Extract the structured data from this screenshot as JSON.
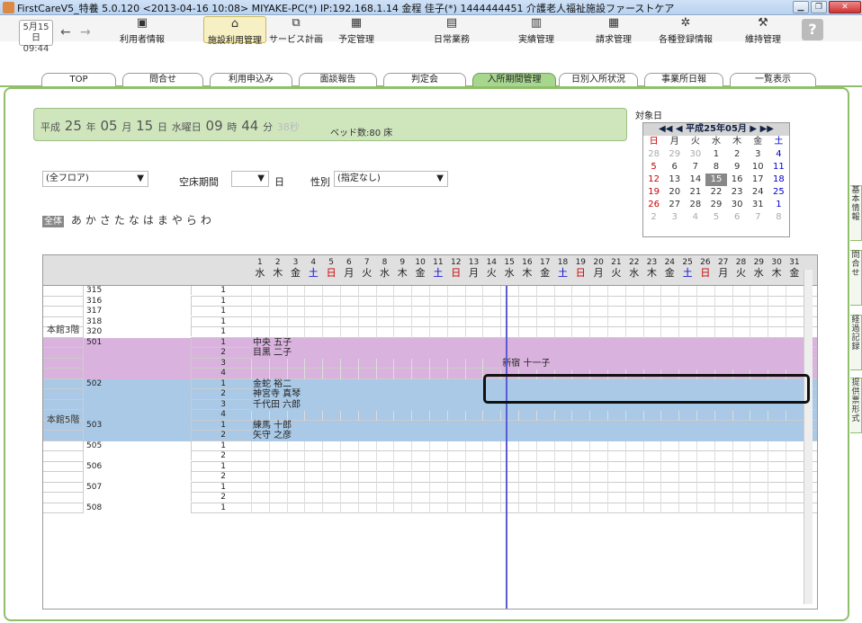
{
  "window": {
    "title": "FirstCareV5_特養 5.0.120 <2013-04-16 10:08> MIYAKE-PC(*) IP:192.168.1.14 金程 佳子(*) 1444444451 介護老人福祉施設ファーストケア"
  },
  "clock": {
    "date": "5月15日",
    "time": "09:44"
  },
  "toolbar": [
    "利用者情報",
    "施設利用管理",
    "サービス計画",
    "予定管理",
    "日常業務",
    "実績管理",
    "請求管理",
    "各種登録情報",
    "維持管理"
  ],
  "tabs": [
    "TOP",
    "問合せ",
    "利用申込み",
    "面談報告",
    "判定会",
    "入所期間管理",
    "日別入所状況",
    "事業所日報",
    "一覧表示"
  ],
  "header": {
    "era": "平成",
    "year": "25",
    "y": "年",
    "month": "05",
    "m": "月",
    "day": "15",
    "d": "日",
    "wday": "水曜日",
    "hour": "09",
    "h": "時",
    "min": "44",
    "mi": "分",
    "sec": "38秒",
    "beds": "ベッド数:80 床"
  },
  "calendar": {
    "label": "対象日",
    "title": "平成25年05月",
    "weekdays": [
      "日",
      "月",
      "火",
      "水",
      "木",
      "金",
      "土"
    ],
    "rows": [
      [
        "28",
        "29",
        "30",
        "1",
        "2",
        "3",
        "4"
      ],
      [
        "5",
        "6",
        "7",
        "8",
        "9",
        "10",
        "11"
      ],
      [
        "12",
        "13",
        "14",
        "15",
        "16",
        "17",
        "18"
      ],
      [
        "19",
        "20",
        "21",
        "22",
        "23",
        "24",
        "25"
      ],
      [
        "26",
        "27",
        "28",
        "29",
        "30",
        "31",
        "1"
      ],
      [
        "2",
        "3",
        "4",
        "5",
        "6",
        "7",
        "8"
      ]
    ]
  },
  "filters": {
    "floor": "(全フロア)",
    "vacancy_label": "空床期間",
    "vacancy_unit": "日",
    "gender_label": "性別",
    "gender": "(指定なし)"
  },
  "kana": {
    "all": "全体",
    "letters": "あかさたなはまやらわ"
  },
  "days": {
    "nums": [
      "1",
      "2",
      "3",
      "4",
      "5",
      "6",
      "7",
      "8",
      "9",
      "10",
      "11",
      "12",
      "13",
      "14",
      "15",
      "16",
      "17",
      "18",
      "19",
      "20",
      "21",
      "22",
      "23",
      "24",
      "25",
      "26",
      "27",
      "28",
      "29",
      "30",
      "31"
    ],
    "wdays": [
      "水",
      "木",
      "金",
      "土",
      "日",
      "月",
      "火",
      "水",
      "木",
      "金",
      "土",
      "日",
      "月",
      "火",
      "水",
      "木",
      "金",
      "土",
      "日",
      "月",
      "火",
      "水",
      "木",
      "金",
      "土",
      "日",
      "月",
      "火",
      "水",
      "木",
      "金"
    ]
  },
  "floors": {
    "f3": "本館3階",
    "f5": "本館5階"
  },
  "rooms": [
    {
      "room": "315",
      "bed": "1"
    },
    {
      "room": "316",
      "bed": "1"
    },
    {
      "room": "317",
      "bed": "1"
    },
    {
      "room": "318",
      "bed": "1"
    },
    {
      "room": "320",
      "bed": "1"
    },
    {
      "room": "501",
      "beds": [
        "1",
        "2",
        "3",
        "4"
      ]
    },
    {
      "room": "502",
      "beds": [
        "1",
        "2",
        "3",
        "4"
      ]
    },
    {
      "room": "503",
      "beds": [
        "1",
        "2"
      ]
    },
    {
      "room": "505",
      "beds": [
        "1",
        "2"
      ]
    },
    {
      "room": "506",
      "beds": [
        "1",
        "2"
      ]
    },
    {
      "room": "507",
      "beds": [
        "1",
        "2"
      ]
    },
    {
      "room": "508",
      "beds": [
        "1"
      ]
    }
  ],
  "residents": [
    "中央 五子",
    "目黒 二子",
    "新宿 十一子",
    "金蛇 裕二",
    "神宮寺 真琴",
    "千代田 六郎",
    "練馬 十郎",
    "矢守 之彦"
  ],
  "righttabs": [
    "基本情報",
    "問合せ",
    "経過記録",
    "提供票形式"
  ]
}
